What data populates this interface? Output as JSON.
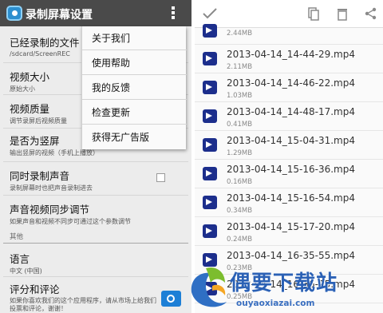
{
  "left": {
    "title": "录制屏幕设置",
    "prefs": [
      {
        "title": "已经录制的文件",
        "summary": "/sdcard/ScreenREC"
      },
      {
        "title": "视频大小",
        "summary": "原始大小"
      },
      {
        "title": "视频质量",
        "summary": "调节录屏后视频质量"
      },
      {
        "title": "是否为竖屏",
        "summary": "输出竖屏的视频（手机上播放）"
      },
      {
        "title": "同时录制声音",
        "summary": "录制屏幕时也把声音录制进去"
      },
      {
        "title": "声音视频同步调节",
        "summary": "如果声音和视频不同步可通过这个参数调节"
      },
      {
        "title": "语言",
        "summary": "中文 (中国)"
      },
      {
        "title": "评分和评论",
        "summary": "如果你喜欢我们的这个应用程序，请从市场上给我们投票和评论，谢谢！"
      }
    ],
    "category": "其他",
    "menu": [
      "关于我们",
      "使用帮助",
      "我的反馈",
      "检查更新",
      "获得无广告版"
    ]
  },
  "right": {
    "top_size": "2.44MB",
    "files": [
      {
        "name": "2013-04-14_14-44-29.mp4",
        "size": "2.11MB"
      },
      {
        "name": "2013-04-14_14-46-22.mp4",
        "size": "1.03MB"
      },
      {
        "name": "2013-04-14_14-48-17.mp4",
        "size": "0.41MB"
      },
      {
        "name": "2013-04-14_15-04-31.mp4",
        "size": "1.29MB"
      },
      {
        "name": "2013-04-14_15-16-36.mp4",
        "size": "0.16MB"
      },
      {
        "name": "2013-04-14_15-16-54.mp4",
        "size": "0.34MB"
      },
      {
        "name": "2013-04-14_15-17-20.mp4",
        "size": "0.24MB"
      },
      {
        "name": "2013-04-14_16-35-55.mp4",
        "size": "0.23MB"
      },
      {
        "name": "2013-04-14_16-36-25.mp4",
        "size": "0.25MB"
      }
    ]
  },
  "watermark": {
    "title": "偶要下载站",
    "url": "ouyaoxiazai.com"
  },
  "colors": {
    "actionbar": "#4a4a4a",
    "video_icon": "#1c2e8c",
    "watermark": "#2b61b5"
  }
}
